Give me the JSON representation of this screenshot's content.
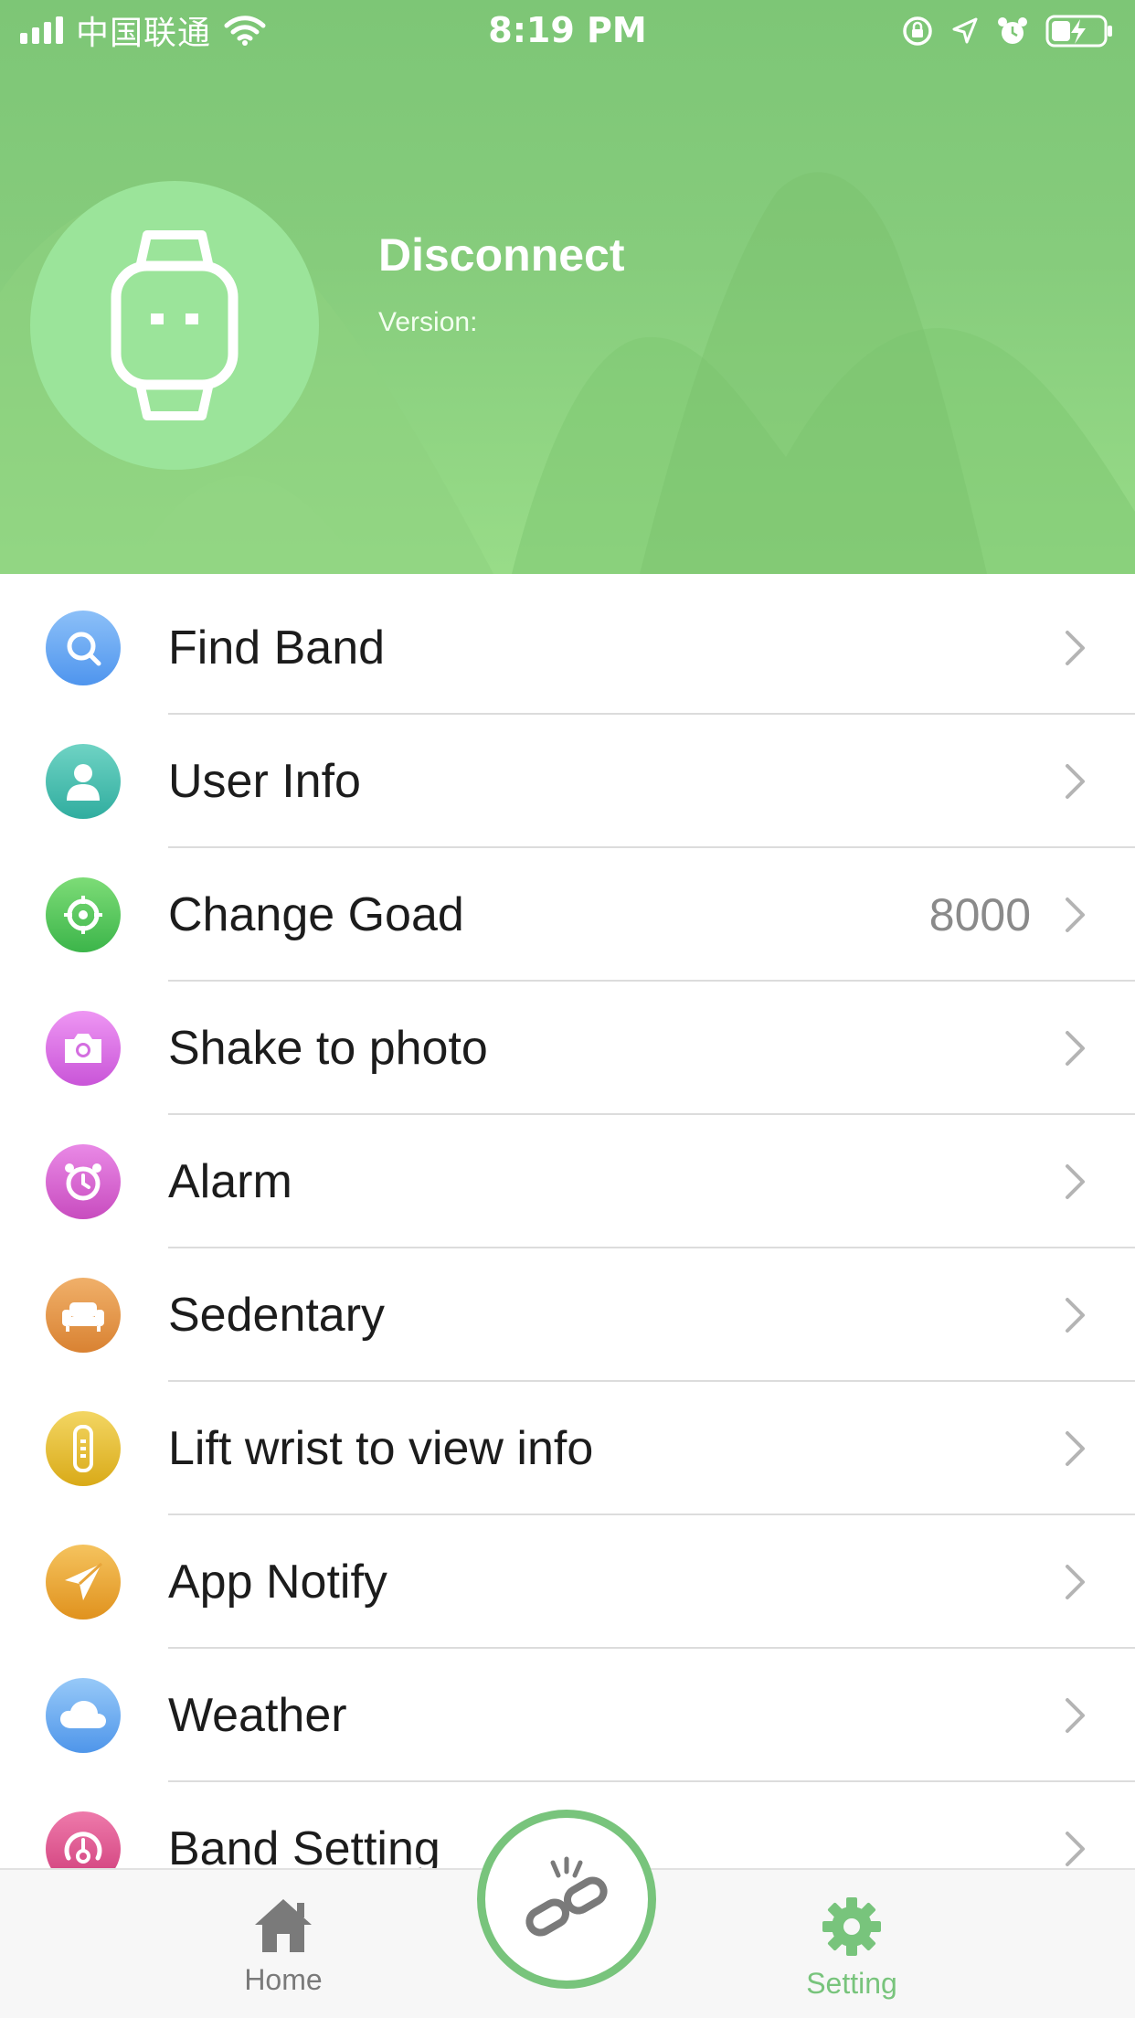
{
  "status_bar": {
    "carrier": "中国联通",
    "time": "8:19 PM",
    "icons": [
      "signal-icon",
      "wifi-icon",
      "rotation-lock-icon",
      "location-icon",
      "alarm-icon",
      "battery-charging-icon"
    ]
  },
  "device": {
    "status": "Disconnect",
    "version_label": "Version:"
  },
  "settings": [
    {
      "label": "Find Band",
      "icon": "search-icon",
      "color": "#5aa2f2"
    },
    {
      "label": "User Info",
      "icon": "user-icon",
      "color": "#3dbdb0"
    },
    {
      "label": "Change Goad",
      "icon": "target-icon",
      "color": "#4fc45a",
      "value": "8000"
    },
    {
      "label": "Shake to photo",
      "icon": "camera-icon",
      "color": "#dd6ee6"
    },
    {
      "label": "Alarm",
      "icon": "alarm-clock-icon",
      "color": "#d65bd2"
    },
    {
      "label": "Sedentary",
      "icon": "sofa-icon",
      "color": "#e59245"
    },
    {
      "label": "Lift wrist to view info",
      "icon": "band-icon",
      "color": "#e7bf2e"
    },
    {
      "label": "App Notify",
      "icon": "paper-plane-icon",
      "color": "#eea62e"
    },
    {
      "label": "Weather",
      "icon": "cloud-icon",
      "color": "#5ba8f0"
    },
    {
      "label": "Band Setting",
      "icon": "gauge-icon",
      "color": "#de4d8a"
    }
  ],
  "tabs": {
    "home_label": "Home",
    "setting_label": "Setting"
  },
  "colors": {
    "accent": "#78c47c",
    "header": "#86cc7c",
    "tab_inactive": "#7a7a7a"
  }
}
